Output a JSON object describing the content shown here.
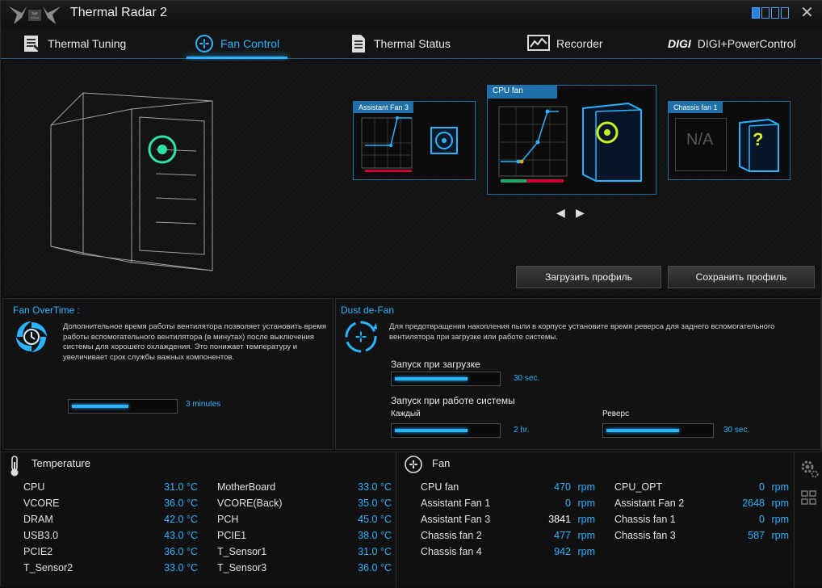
{
  "app": {
    "title": "Thermal Radar 2",
    "logo_text": "TUF THE ULTIMATE FORCE"
  },
  "tabs": [
    {
      "label": "Thermal Tuning",
      "icon": "clipboard-icon"
    },
    {
      "label": "Fan Control",
      "icon": "fan-icon",
      "active": true
    },
    {
      "label": "Thermal Status",
      "icon": "document-icon"
    },
    {
      "label": "Recorder",
      "icon": "chart-icon"
    },
    {
      "label": "DIGI+PowerControl",
      "icon": "digi-icon",
      "prefix": "DIGI"
    }
  ],
  "fans": {
    "left": {
      "label": "Assistant Fan 3"
    },
    "center": {
      "label": "CPU fan"
    },
    "right": {
      "label": "Chassis fan 1",
      "na": "N/A",
      "q": "?"
    }
  },
  "buttons": {
    "load": "Загрузить профиль",
    "save": "Сохранить профиль"
  },
  "overtime": {
    "title": "Fan OverTime :",
    "desc": "Дополнительное время работы вентилятора позволяет установить время работы вспомогательного вентилятора (в минутах) после выключения системы для хорошего охлаждения. Это понижает температуру и увеличивает срок службы важных компонентов.",
    "value": "3 minutes",
    "level": 0.55
  },
  "dust": {
    "title": "Dust de-Fan",
    "desc": "Для предотвращения накопления пыли в корпусе установите время реверса для заднего вспомогательного вентилятора при  загрузке или работе системы.",
    "boot_label": "Запуск при загрузке",
    "boot_value": "30 sec.",
    "boot_level": 0.7,
    "run_label": "Запуск при работе системы",
    "every_label": "Каждый",
    "every_value": "2 hr.",
    "every_level": 0.7,
    "reverse_label": "Реверс",
    "reverse_value": "30 sec.",
    "reverse_level": 0.7
  },
  "temperature": {
    "title": "Temperature",
    "left": [
      {
        "name": "CPU",
        "value": "31.0 °C"
      },
      {
        "name": "VCORE",
        "value": "36.0 °C"
      },
      {
        "name": "DRAM",
        "value": "42.0 °C"
      },
      {
        "name": "USB3.0",
        "value": "43.0 °C"
      },
      {
        "name": "PCIE2",
        "value": "36.0 °C"
      },
      {
        "name": "T_Sensor2",
        "value": "33.0 °C"
      }
    ],
    "right": [
      {
        "name": "MotherBoard",
        "value": "33.0 °C"
      },
      {
        "name": "VCORE(Back)",
        "value": "35.0 °C"
      },
      {
        "name": "PCH",
        "value": "45.0 °C"
      },
      {
        "name": "PCIE1",
        "value": "38.0 °C"
      },
      {
        "name": "T_Sensor1",
        "value": "31.0 °C"
      },
      {
        "name": "T_Sensor3",
        "value": "36.0 °C"
      }
    ]
  },
  "fan": {
    "title": "Fan",
    "unit": "rpm",
    "left": [
      {
        "name": "CPU fan",
        "value": "470"
      },
      {
        "name": "Assistant Fan 1",
        "value": "0"
      },
      {
        "name": "Assistant Fan 3",
        "value": "3841"
      },
      {
        "name": "Chassis fan 2",
        "value": "477"
      },
      {
        "name": "Chassis fan 4",
        "value": "942"
      }
    ],
    "right": [
      {
        "name": "CPU_OPT",
        "value": "0"
      },
      {
        "name": "Assistant Fan 2",
        "value": "2648"
      },
      {
        "name": "Chassis fan 1",
        "value": "0"
      },
      {
        "name": "Chassis fan 3",
        "value": "587"
      }
    ]
  },
  "colors": {
    "accent": "#2ab4ff",
    "panel_border": "#1f6fa8"
  }
}
